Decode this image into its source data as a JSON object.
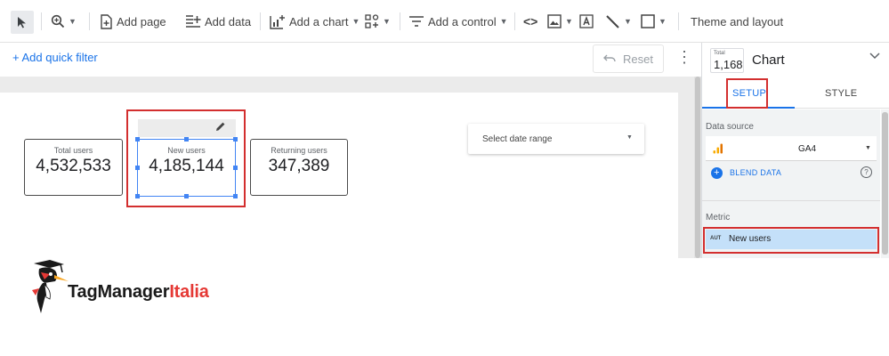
{
  "toolbar": {
    "add_page": "Add page",
    "add_data": "Add data",
    "add_chart": "Add a chart",
    "add_control": "Add a control",
    "code_glyph": "<>",
    "theme_layout": "Theme and layout"
  },
  "filter_bar": {
    "add_quick_filter": "+ Add quick filter",
    "reset": "Reset"
  },
  "canvas": {
    "scorecards": [
      {
        "label": "Total users",
        "value": "4,532,533"
      },
      {
        "label": "New users",
        "value": "4,185,144"
      },
      {
        "label": "Returning users",
        "value": "347,389"
      }
    ],
    "date_range": "Select date range"
  },
  "panel": {
    "chart_icon_label": "Total",
    "chart_icon_value": "1,168",
    "chart_name": "Chart",
    "tabs": {
      "setup": "SETUP",
      "style": "STYLE"
    },
    "data_source_title": "Data source",
    "data_source_name": "GA4",
    "blend_data": "BLEND DATA",
    "help_glyph": "?",
    "metric_title": "Metric",
    "metric_type": "AUT",
    "metric_name": "New users"
  },
  "logo": {
    "part1": "TagManager",
    "part2": "Italia"
  },
  "colors": {
    "accent": "#1a73e8",
    "highlight": "#d32f2f",
    "selection": "#4285f4",
    "metric_bg": "#c4e0f9"
  }
}
